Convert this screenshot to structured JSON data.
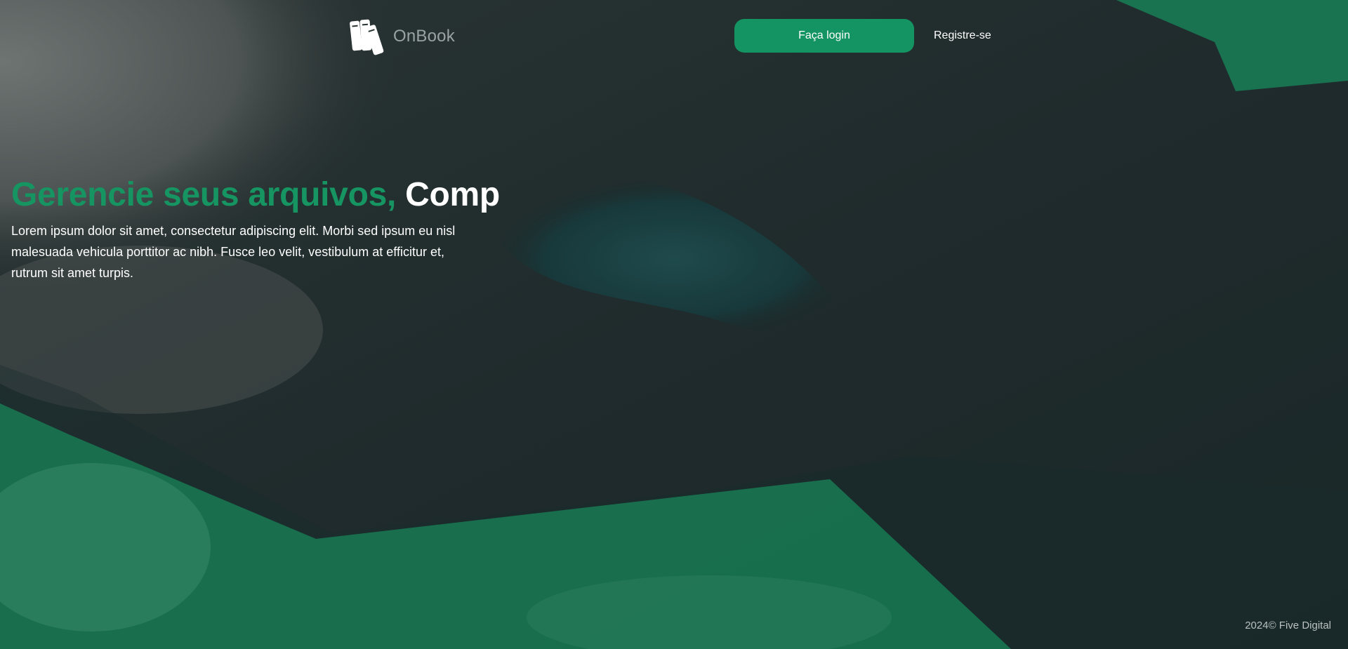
{
  "header": {
    "logo_text": "OnBook",
    "logo_icon": "books-icon",
    "login_label": "Faça login",
    "register_label": "Registre-se"
  },
  "hero": {
    "title_accent": "Gerencie seus arquivos,",
    "title_typed": "Comp",
    "description": "Lorem ipsum dolor sit amet, consectetur adipiscing elit. Morbi sed ipsum eu nisl malesuada vehicula porttitor ac nibh. Fusce leo velit, vestibulum at efficitur et, rutrum sit amet turpis."
  },
  "footer": {
    "copyright": "2024© Five Digital"
  },
  "colors": {
    "accent": "#169461",
    "button": "#149462",
    "background": "#1c2424",
    "overlay_green": "#187a54"
  }
}
